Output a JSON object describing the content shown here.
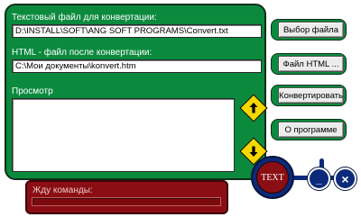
{
  "source": {
    "label": "Текстовый файл для конвертации:",
    "value": "D:\\INSTALL\\SOFT\\ANG SOFT PROGRAMS\\Convert.txt"
  },
  "output": {
    "label": "HTML - файл после конвертации:",
    "value": "C:\\Мои документы\\konvert.htm"
  },
  "preview": {
    "label": "Просмотр"
  },
  "buttons": {
    "select_file": "Выбор файла",
    "html_file": "Файл HTML ...",
    "convert": "Конвертировать",
    "about": "О программе"
  },
  "round_buttons": {
    "text": "TEXT",
    "minimize": "_",
    "close": "×"
  },
  "status": {
    "text": "Жду команды:"
  },
  "colors": {
    "panel_green": "#0b8a3e",
    "status_red": "#8a0e13",
    "arrow_yellow": "#f4d800",
    "round_blue": "#0b2a7a"
  },
  "icons": {
    "up": "arrow-up-sign-icon",
    "down": "arrow-down-sign-icon"
  }
}
